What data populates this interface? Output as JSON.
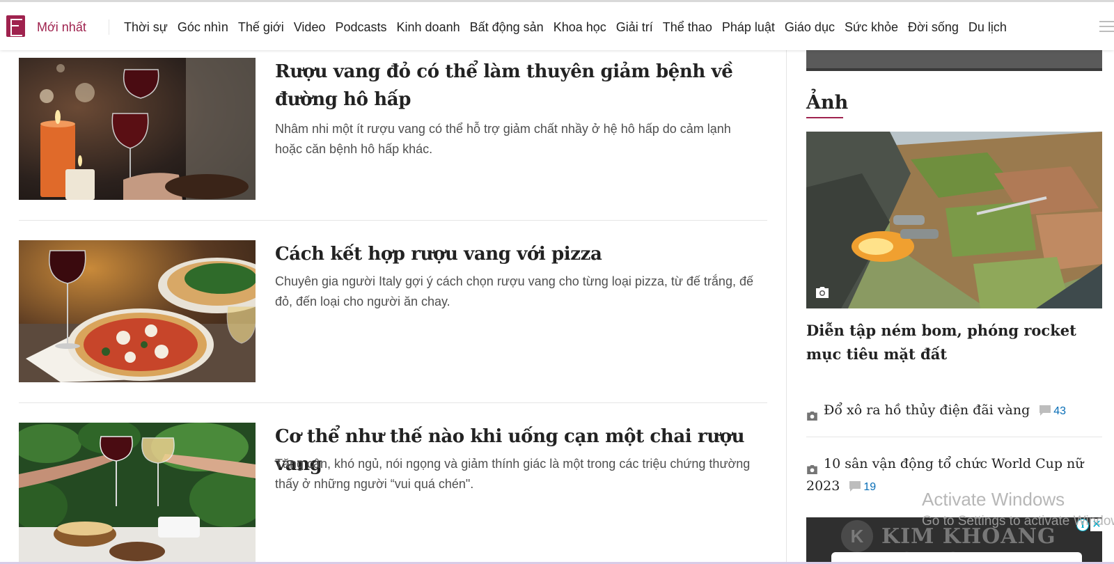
{
  "nav": {
    "latest": "Mới nhất",
    "items": [
      "Thời sự",
      "Góc nhìn",
      "Thế giới",
      "Video",
      "Podcasts",
      "Kinh doanh",
      "Bất động sản",
      "Khoa học",
      "Giải trí",
      "Thể thao",
      "Pháp luật",
      "Giáo dục",
      "Sức khỏe",
      "Đời sống",
      "Du lịch"
    ]
  },
  "articles": [
    {
      "title": "Rượu vang đỏ có thể làm thuyên giảm bệnh về đường hô hấp",
      "description": "Nhâm nhi một ít rượu vang có thể hỗ trợ giảm chất nhầy ở hệ hô hấp do cảm lạnh hoặc căn bệnh hô hấp khác."
    },
    {
      "title": "Cách kết hợp rượu vang với pizza",
      "description": "Chuyên gia người Italy gợi ý cách chọn rượu vang cho từng loại pizza, từ đế trắng, đế đỏ, đến loại cho người ăn chay."
    },
    {
      "title": "Cơ thể như thế nào khi uống cạn một chai rượu vang",
      "description": "Tăng cân, khó ngủ, nói ngọng và giảm thính giác là một trong các triệu chứng thường thấy ở những người “vui quá chén\"."
    }
  ],
  "sidebar": {
    "section_title": "Ảnh",
    "featured_title": "Diễn tập ném bom, phóng rocket mục tiêu mặt đất",
    "items": [
      {
        "title": "Đổ xô ra hồ thủy điện đãi vàng",
        "comments": "43"
      },
      {
        "title": "10 sân vận động tổ chức World Cup nữ 2023",
        "comments": "19"
      }
    ]
  },
  "ad": {
    "brand_letter": "K",
    "text": "KIM KHOANG TOEIC"
  },
  "windows_watermark": {
    "title": "Activate Windows",
    "subtitle": "Go to Settings to activate Windows."
  },
  "colors": {
    "brand": "#9f224e",
    "comment": "#076db6"
  },
  "icons": [
    "vnexpress-logo-icon",
    "menu-icon",
    "camera-icon",
    "comment-icon",
    "ad-info-icon",
    "close-icon"
  ]
}
